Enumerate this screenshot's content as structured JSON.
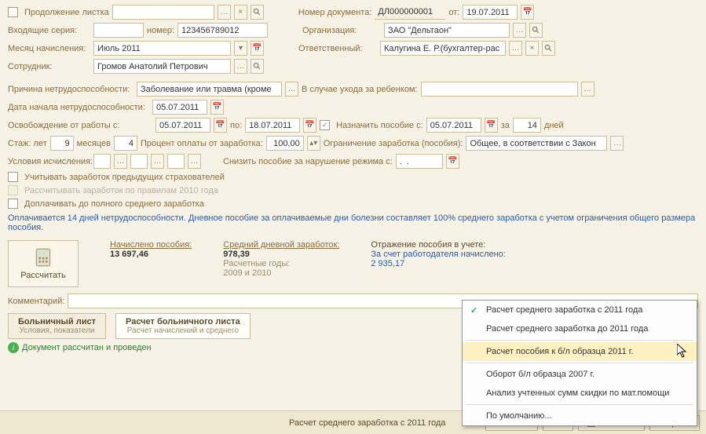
{
  "header": {
    "continuation_label": "Продолжение листка",
    "continuation_value": "",
    "doc_num_label": "Номер документа:",
    "doc_num": "ДЛ000000001",
    "date_from_label": "от:",
    "date_from": "19.07.2011",
    "incoming_series_label": "Входящие серия:",
    "incoming_series": "",
    "number_label": "номер:",
    "number": "123456789012",
    "org_label": "Организация:",
    "org": "ЗАО \"Дельтаон\"",
    "month_label": "Месяц начисления:",
    "month": "Июль 2011",
    "resp_label": "Ответственный:",
    "resp": "Калугина Е. Р.(бухгалтер-рас",
    "employee_label": "Сотрудник:",
    "employee": "Громов Анатолий Петрович"
  },
  "body": {
    "reason_label": "Причина нетрудоспособности:",
    "reason": "Заболевание или травма (кроме",
    "child_care_label": "В случае ухода за ребенком:",
    "child_care": "",
    "start_date_label": "Дата начала нетрудоспособности:",
    "start_date": "05.07.2011",
    "release_label": "Освобождение от работы с:",
    "release_from": "05.07.2011",
    "to_label": "по:",
    "release_to": "18.07.2011",
    "assign_label": "Назначить пособие с:",
    "assign_from": "05.07.2011",
    "for_label": "за",
    "days": "14",
    "days_label": "дней",
    "stazh_label": "Стаж: лет",
    "stazh_years": "9",
    "months_label": "месяцев",
    "stazh_months": "4",
    "percent_label": "Процент оплаты от заработка:",
    "percent": "100,00",
    "limit_label": "Ограничение заработка (пособия):",
    "limit": "Общее, в соответствии с Закон",
    "conditions_label": "Условия исчисления:",
    "reduce_label": "Снизить пособие за нарушение режима с:",
    "reduce_date": ".  .",
    "chk1_label": "Учитывать заработок предыдущих страхователей",
    "chk2_label": "Рассчитывать заработок по правилам 2010 года",
    "chk3_label": "Доплачивать до полного среднего заработка"
  },
  "info": "Оплачивается 14 дней нетрудоспособности. Дневное пособие за оплачиваемые дни болезни составляет 100% среднего заработка с учетом ограничения общего размера пособия.",
  "summary": {
    "calc_button": "Рассчитать",
    "accrued_label": "Начислено пособия:",
    "accrued": "13 697,46",
    "avg_label": "Средний дневной заработок:",
    "avg": "978,39",
    "years_label": "Расчетные годы:",
    "years": "2009 и 2010",
    "refl_label": "Отражение пособия в учете:",
    "refl_text": "За счет работодателя начислено:",
    "refl_amount": "2 935,17"
  },
  "comment_label": "Комментарий:",
  "comment": "",
  "tabs": [
    {
      "title": "Больничный лист",
      "sub": "Условия, показатели"
    },
    {
      "title": "Расчет больничного листа",
      "sub": "Расчет начислений и среднего"
    }
  ],
  "status_text": "Документ рассчитан и проведен",
  "dropdown": {
    "items": [
      "Расчет среднего заработка с 2011 года",
      "Расчет среднего заработка до 2011 года",
      "Расчет пособия к б/л образца 2011 г.",
      "Оборот б/л образца 2007 г.",
      "Анализ учтенных сумм скидки по мат.помощи"
    ],
    "default": "По умолчанию..."
  },
  "footer": {
    "hint": "Расчет среднего заработка с 2011 года",
    "print": "Печать",
    "ok": "OK",
    "save": "Записать",
    "close": "Закрыть"
  }
}
